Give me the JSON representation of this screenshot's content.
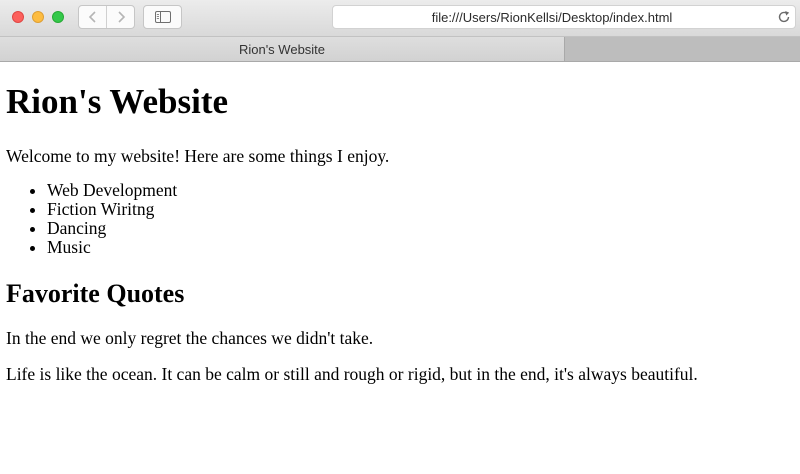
{
  "browser": {
    "address": "file:///Users/RionKellsi/Desktop/index.html",
    "tab_title": "Rion's Website",
    "icons": [
      "close-icon",
      "minimize-icon",
      "maximize-icon",
      "back-icon",
      "forward-icon",
      "sidebar-icon",
      "reload-icon"
    ]
  },
  "page": {
    "title": "Rion's Website",
    "intro": "Welcome to my website! Here are some things I enjoy.",
    "enjoy_items": [
      "Web Development",
      "Fiction Wiritng",
      "Dancing",
      "Music"
    ],
    "quotes_heading": "Favorite Quotes",
    "quotes": [
      "In the end we only regret the chances we didn't take.",
      "Life is like the ocean. It can be calm or still and rough or rigid, but in the end, it's always beautiful."
    ]
  }
}
